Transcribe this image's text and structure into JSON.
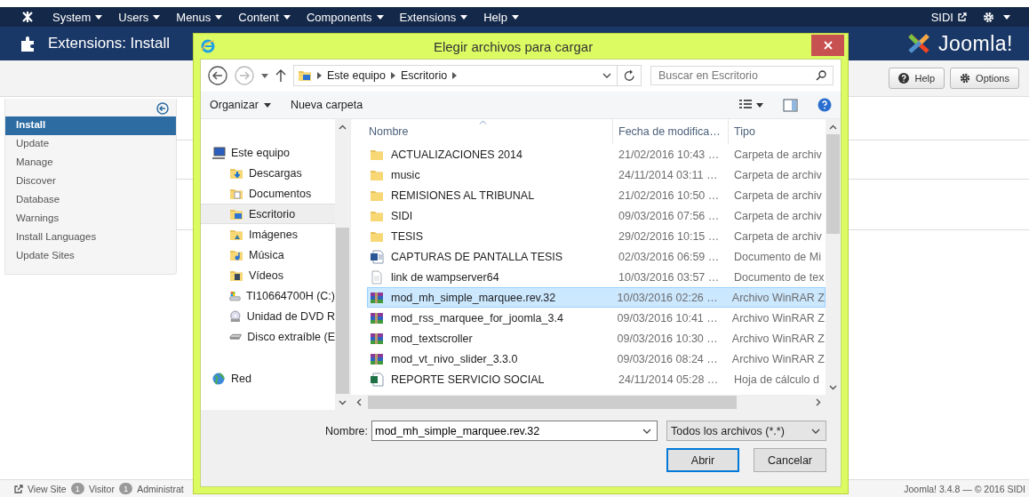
{
  "admin": {
    "menu": [
      {
        "label": "System"
      },
      {
        "label": "Users"
      },
      {
        "label": "Menus"
      },
      {
        "label": "Content"
      },
      {
        "label": "Components"
      },
      {
        "label": "Extensions"
      },
      {
        "label": "Help"
      }
    ],
    "user": "SIDI",
    "page_title": "Extensions: Install",
    "brand": "Joomla!",
    "toolbar": [
      {
        "kind": "help",
        "label": "Help"
      },
      {
        "kind": "options",
        "label": "Options"
      }
    ],
    "sidebar": [
      {
        "label": "Install",
        "selected": true
      },
      {
        "label": "Update",
        "selected": false
      },
      {
        "label": "Manage",
        "selected": false
      },
      {
        "label": "Discover",
        "selected": false
      },
      {
        "label": "Database",
        "selected": false
      },
      {
        "label": "Warnings",
        "selected": false
      },
      {
        "label": "Install Languages",
        "selected": false
      },
      {
        "label": "Update Sites",
        "selected": false
      }
    ],
    "status_bar": {
      "view_site": "View Site",
      "visitors": {
        "count": "1",
        "label": "Visitor"
      },
      "admins": {
        "count": "1",
        "label": "Administrat"
      },
      "footer": "Joomla! 3.4.8 — © 2016 SIDI"
    }
  },
  "dialog": {
    "title": "Elegir archivos para cargar",
    "path": [
      "Este equipo",
      "Escritorio"
    ],
    "search": {
      "placeholder": "Buscar en Escritorio"
    },
    "commands": [
      {
        "label": "Organizar",
        "dropdown": true
      },
      {
        "label": "Nueva carpeta",
        "dropdown": false
      }
    ],
    "nav": [
      {
        "kind": "computer",
        "label": "Este equipo",
        "selected": false,
        "children": [
          {
            "kind": "downloads",
            "label": "Descargas",
            "selected": false
          },
          {
            "kind": "documents",
            "label": "Documentos",
            "selected": false
          },
          {
            "kind": "desktop",
            "label": "Escritorio",
            "selected": true
          },
          {
            "kind": "pictures",
            "label": "Imágenes",
            "selected": false
          },
          {
            "kind": "music",
            "label": "Música",
            "selected": false
          },
          {
            "kind": "videos",
            "label": "Vídeos",
            "selected": false
          },
          {
            "kind": "drive",
            "label": "TI10664700H (C:)",
            "selected": false
          },
          {
            "kind": "dvd",
            "label": "Unidad de DVD R",
            "selected": false
          },
          {
            "kind": "removable",
            "label": "Disco extraíble (E",
            "selected": false
          }
        ]
      },
      {
        "kind": "network",
        "label": "Red",
        "selected": false
      }
    ],
    "columns": [
      "Nombre",
      "Fecha de modifica…",
      "Tipo"
    ],
    "files": [
      {
        "kind": "folder",
        "name": "ACTUALIZACIONES 2014",
        "date": "21/02/2016 10:43 …",
        "type": "Carpeta de archiv",
        "selected": false
      },
      {
        "kind": "folder",
        "name": "music",
        "date": "24/11/2014 03:11 …",
        "type": "Carpeta de archiv",
        "selected": false
      },
      {
        "kind": "folder",
        "name": "REMISIONES AL TRIBUNAL",
        "date": "21/02/2016 10:50 …",
        "type": "Carpeta de archiv",
        "selected": false
      },
      {
        "kind": "folder",
        "name": "SIDI",
        "date": "09/03/2016 07:56 …",
        "type": "Carpeta de archiv",
        "selected": false
      },
      {
        "kind": "folder",
        "name": "TESIS",
        "date": "29/02/2016 10:15 …",
        "type": "Carpeta de archiv",
        "selected": false
      },
      {
        "kind": "word",
        "name": "CAPTURAS DE PANTALLA TESIS",
        "date": "02/03/2016 06:59 …",
        "type": "Documento de Mi",
        "selected": false
      },
      {
        "kind": "text",
        "name": "link de wampserver64",
        "date": "10/03/2016 03:57 …",
        "type": "Documento de tex",
        "selected": false
      },
      {
        "kind": "archive",
        "name": "mod_mh_simple_marquee.rev.32",
        "date": "10/03/2016 02:26 …",
        "type": "Archivo WinRAR Z",
        "selected": true
      },
      {
        "kind": "archive",
        "name": "mod_rss_marquee_for_joomla_3.4",
        "date": "09/03/2016 10:41 …",
        "type": "Archivo WinRAR Z",
        "selected": false
      },
      {
        "kind": "archive",
        "name": "mod_textscroller",
        "date": "09/03/2016 10:30 …",
        "type": "Archivo WinRAR Z",
        "selected": false
      },
      {
        "kind": "archive",
        "name": "mod_vt_nivo_slider_3.3.0",
        "date": "09/03/2016 08:24 …",
        "type": "Archivo WinRAR Z",
        "selected": false
      },
      {
        "kind": "sheet",
        "name": "REPORTE SERVICIO SOCIAL",
        "date": "24/11/2014 05:28 …",
        "type": "Hoja de cálculo d",
        "selected": false
      }
    ],
    "file_name": {
      "label": "Nombre:",
      "value": "mod_mh_simple_marquee.rev.32"
    },
    "filter": "Todos los archivos (*.*)",
    "buttons": [
      {
        "label": "Abrir",
        "default": true
      },
      {
        "label": "Cancelar",
        "default": false
      }
    ]
  }
}
